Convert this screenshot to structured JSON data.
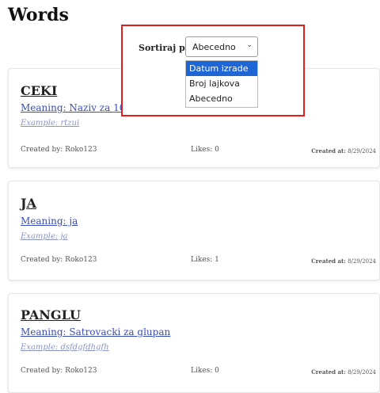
{
  "page": {
    "title": "Words"
  },
  "sort": {
    "label": "Sortiraj po:",
    "selected": "Abecedno",
    "options": [
      "Datum izrade",
      "Broj lajkova",
      "Abecedno"
    ],
    "highlighted_option": "Datum izrade",
    "highlight_color": "#1e66d6",
    "frame_color": "#e11d1d"
  },
  "words": [
    {
      "word": "CEKI",
      "meaning": "Meaning: Naziv za 10 eura",
      "example": "Example: rtzui",
      "created_by": "Created by: Roko123",
      "likes": "Likes: 0",
      "created_at_label": "Created at:",
      "created_at_value": "8/29/2024"
    },
    {
      "word": "JA",
      "meaning": "Meaning: ja",
      "example": "Example: ja",
      "created_by": "Created by: Roko123",
      "likes": "Likes: 1",
      "created_at_label": "Created at:",
      "created_at_value": "8/29/2024"
    },
    {
      "word": "PANGLU",
      "meaning": "Meaning: Satrovacki za glupan",
      "example": "Example: dsfdgfdhgfh",
      "created_by": "Created by: Roko123",
      "likes": "Likes: 0",
      "created_at_label": "Created at:",
      "created_at_value": "8/29/2024"
    }
  ]
}
